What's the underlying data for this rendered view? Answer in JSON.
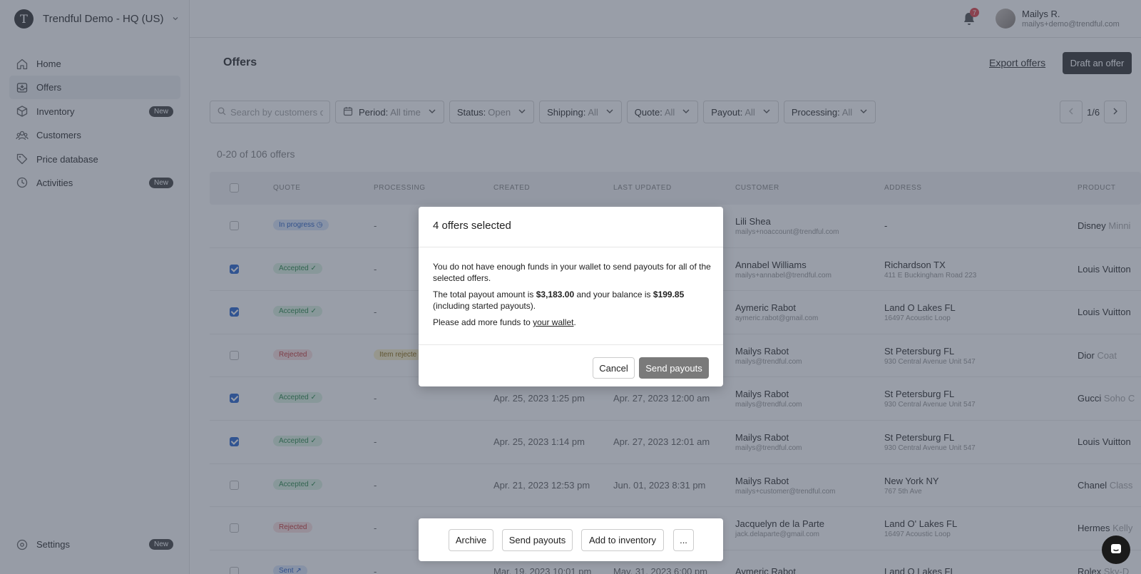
{
  "org": {
    "logo_letter": "T",
    "name": "Trendful Demo - HQ (US)"
  },
  "sidebar": {
    "items": [
      {
        "label": "Home",
        "icon": "home-icon"
      },
      {
        "label": "Offers",
        "icon": "inbox-icon",
        "active": true
      },
      {
        "label": "Inventory",
        "icon": "box-icon",
        "badge": "New"
      },
      {
        "label": "Customers",
        "icon": "users-icon"
      },
      {
        "label": "Price database",
        "icon": "tag-icon"
      },
      {
        "label": "Activities",
        "icon": "clock-icon",
        "badge": "New"
      }
    ],
    "settings": {
      "label": "Settings",
      "badge": "New",
      "icon": "gear-icon"
    }
  },
  "header": {
    "notifications": "7",
    "user_name": "Mailys R.",
    "user_email": "mailys+demo@trendful.com"
  },
  "page": {
    "title": "Offers",
    "export_label": "Export offers",
    "draft_label": "Draft an offer",
    "count_text": "0-20 of 106 offers"
  },
  "filters": {
    "search_placeholder": "Search by customers or",
    "chips": [
      {
        "key": "Period:",
        "value": "All time"
      },
      {
        "key": "Status:",
        "value": "Open"
      },
      {
        "key": "Shipping:",
        "value": "All"
      },
      {
        "key": "Quote:",
        "value": "All"
      },
      {
        "key": "Payout:",
        "value": "All"
      },
      {
        "key": "Processing:",
        "value": "All"
      }
    ],
    "page_indicator": "1/6"
  },
  "table": {
    "columns": [
      "QUOTE",
      "PROCESSING",
      "CREATED",
      "LAST UPDATED",
      "CUSTOMER",
      "ADDRESS",
      "PRODUCT"
    ],
    "rows": [
      {
        "checked": false,
        "quote": "In progress ◷",
        "quote_kind": "in-progress",
        "processing": "-",
        "processing_kind": "",
        "created": "",
        "updated": "",
        "customer": "Lili Shea",
        "email": "mailys+noaccount@trendful.com",
        "address": "-",
        "address_sub": "",
        "brand": "Disney",
        "model": "Minni"
      },
      {
        "checked": true,
        "quote": "Accepted ✓",
        "quote_kind": "accepted",
        "processing": "-",
        "processing_kind": "",
        "created": "",
        "updated": "",
        "customer": "Annabel Williams",
        "email": "mailys+annabel@trendful.com",
        "address": "Richardson TX",
        "address_sub": "411 E Buckingham Road 223",
        "brand": "Louis Vuitton",
        "model": ""
      },
      {
        "checked": true,
        "quote": "Accepted ✓",
        "quote_kind": "accepted",
        "processing": "-",
        "processing_kind": "",
        "created": "",
        "updated": "",
        "customer": "Aymeric Rabot",
        "email": "aymeric.rabot@gmail.com",
        "address": "Land O Lakes FL",
        "address_sub": "16497 Acoustic Loop",
        "brand": "Louis Vuitton",
        "model": ""
      },
      {
        "checked": false,
        "quote": "Rejected",
        "quote_kind": "rejected",
        "processing": "Item rejecte",
        "processing_kind": "item-rejected",
        "created": "",
        "updated": "",
        "customer": "Mailys Rabot",
        "email": "mailys@trendful.com",
        "address": "St Petersburg FL",
        "address_sub": "930 Central Avenue Unit 547",
        "brand": "Dior",
        "model": "Coat"
      },
      {
        "checked": true,
        "quote": "Accepted ✓",
        "quote_kind": "accepted",
        "processing": "-",
        "processing_kind": "",
        "created": "Apr. 25, 2023 1:25 pm",
        "updated": "Apr. 27, 2023 12:00 am",
        "customer": "Mailys Rabot",
        "email": "mailys@trendful.com",
        "address": "St Petersburg FL",
        "address_sub": "930 Central Avenue Unit 547",
        "brand": "Gucci",
        "model": "Soho C"
      },
      {
        "checked": true,
        "quote": "Accepted ✓",
        "quote_kind": "accepted",
        "processing": "-",
        "processing_kind": "",
        "created": "Apr. 25, 2023 1:14 pm",
        "updated": "Apr. 27, 2023 12:01 am",
        "customer": "Mailys Rabot",
        "email": "mailys@trendful.com",
        "address": "St Petersburg FL",
        "address_sub": "930 Central Avenue Unit 547",
        "brand": "Louis Vuitton",
        "model": ""
      },
      {
        "checked": false,
        "quote": "Accepted ✓",
        "quote_kind": "accepted",
        "processing": "-",
        "processing_kind": "",
        "created": "Apr. 21, 2023 12:53 pm",
        "updated": "Jun. 01, 2023 8:31 pm",
        "customer": "Mailys Rabot",
        "email": "mailys+customer@trendful.com",
        "address": "New York NY",
        "address_sub": "767 5th Ave",
        "brand": "Chanel",
        "model": "Class"
      },
      {
        "checked": false,
        "quote": "Rejected",
        "quote_kind": "rejected",
        "processing": "-",
        "processing_kind": "",
        "created": "",
        "updated": "",
        "customer": "Jacquelyn de la Parte",
        "email": "jack.delaparte@gmail.com",
        "address": "Land O' Lakes FL",
        "address_sub": "16497 Acoustic Loop",
        "brand": "Hermes",
        "model": "Kelly"
      },
      {
        "checked": false,
        "quote": "Sent ↗",
        "quote_kind": "sent",
        "processing": "-",
        "processing_kind": "",
        "created": "Mar. 19, 2023 10:01 pm",
        "updated": "May. 31, 2023 6:00 pm",
        "customer": "Aymeric Rabot",
        "email": "",
        "address": "Land O Lakes FL",
        "address_sub": "",
        "brand": "Rolex",
        "model": "Sky-D"
      }
    ]
  },
  "modal": {
    "title": "4 offers selected",
    "line1": "You do not have enough funds in your wallet to send payouts for all of the selected offers.",
    "line2_prefix": "The total payout amount is ",
    "total": "$3,183.00",
    "line2_mid": " and your balance is ",
    "balance": "$199.85",
    "line2_suffix": " (including started payouts).",
    "line3_prefix": "Please add more funds to ",
    "wallet_link": "your wallet",
    "line3_suffix": ".",
    "cancel_label": "Cancel",
    "send_label": "Send payouts"
  },
  "actionbar": {
    "archive_label": "Archive",
    "send_label": "Send payouts",
    "inventory_label": "Add to inventory",
    "more_label": "..."
  },
  "colors": {
    "accent": "#2f6bd1",
    "dark": "#3b3b3b",
    "overlay": "#343e52"
  }
}
